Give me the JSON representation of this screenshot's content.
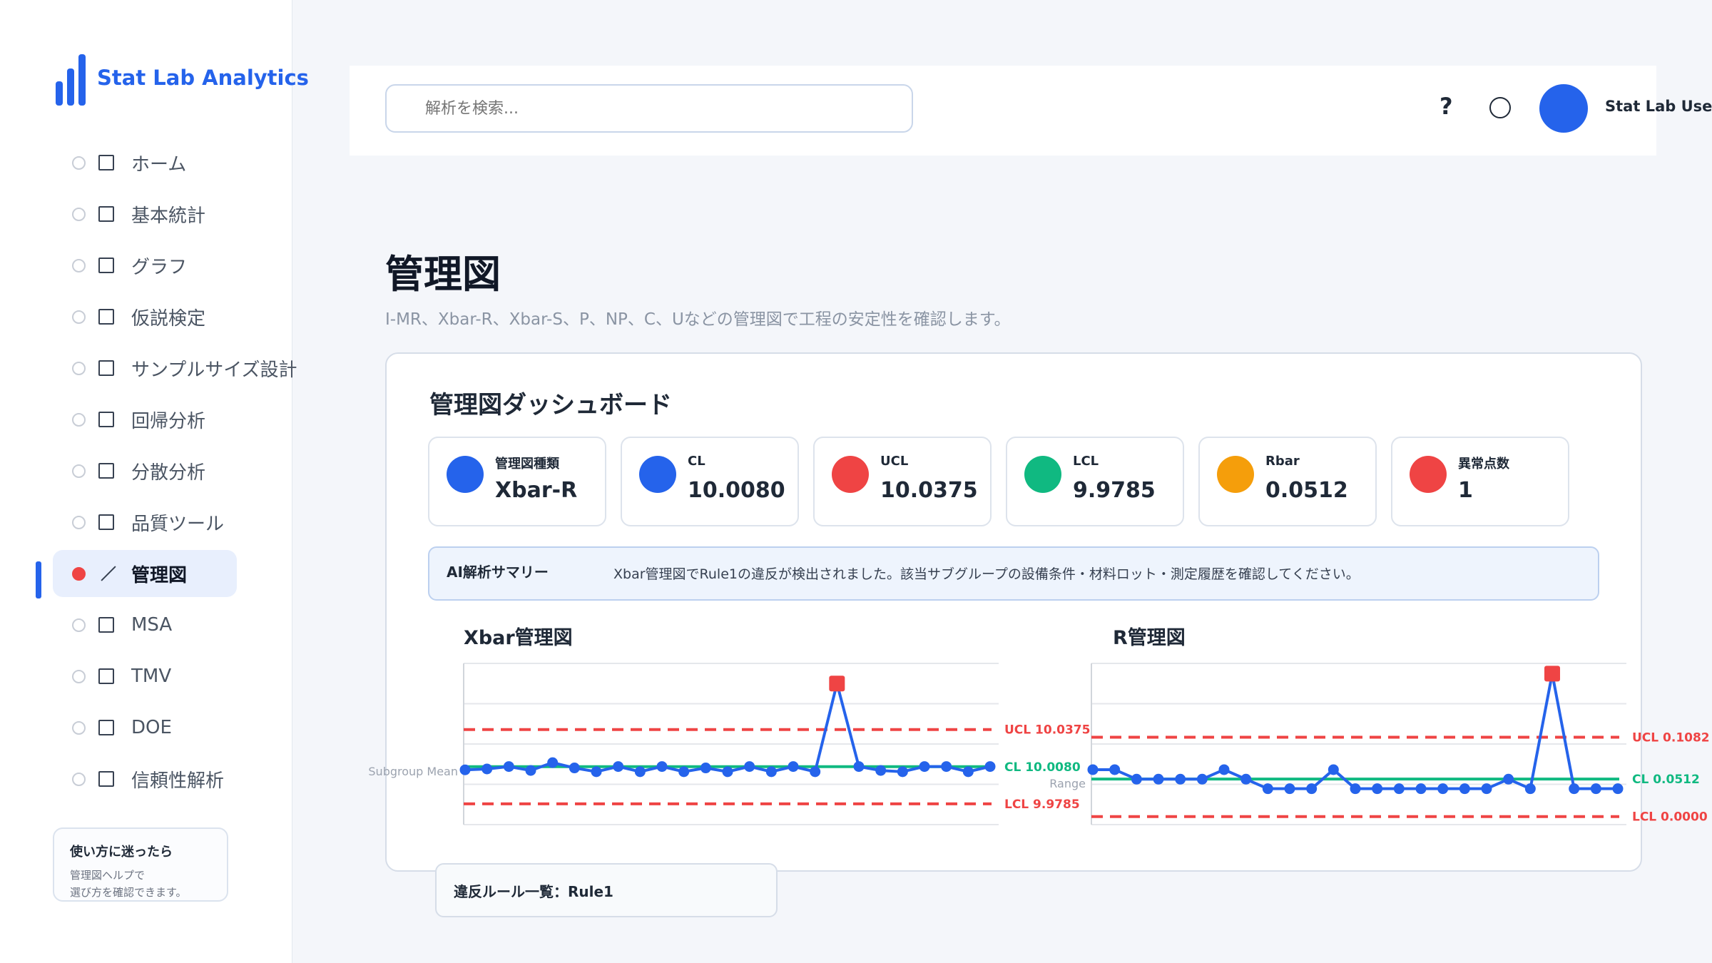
{
  "brand": {
    "name": "Stat Lab Analytics"
  },
  "sidebar": {
    "items": [
      {
        "label": "ホーム"
      },
      {
        "label": "基本統計"
      },
      {
        "label": "グラフ"
      },
      {
        "label": "仮説検定"
      },
      {
        "label": "サンプルサイズ設計"
      },
      {
        "label": "回帰分析"
      },
      {
        "label": "分散分析"
      },
      {
        "label": "品質ツール"
      },
      {
        "label": "管理図"
      },
      {
        "label": "MSA"
      },
      {
        "label": "TMV"
      },
      {
        "label": "DOE"
      },
      {
        "label": "信頼性解析"
      }
    ],
    "active_index": 8,
    "help": {
      "title": "使い方に迷ったら",
      "line1": "管理図ヘルプで",
      "line2": "選び方を確認できます。"
    }
  },
  "topbar": {
    "search_placeholder": "解析を検索...",
    "help_icon": "?",
    "username": "Stat Lab User"
  },
  "page": {
    "title": "管理図",
    "subtitle": "I-MR、Xbar-R、Xbar-S、P、NP、C、Uなどの管理図で工程の安定性を確認します。"
  },
  "dashboard": {
    "title": "管理図ダッシュボード",
    "kpis": [
      {
        "label": "管理図種類",
        "value": "Xbar-R",
        "color": "#2563eb"
      },
      {
        "label": "CL",
        "value": "10.0080",
        "color": "#2563eb"
      },
      {
        "label": "UCL",
        "value": "10.0375",
        "color": "#ef4444"
      },
      {
        "label": "LCL",
        "value": "9.9785",
        "color": "#10b981"
      },
      {
        "label": "Rbar",
        "value": "0.0512",
        "color": "#f59e0b"
      },
      {
        "label": "異常点数",
        "value": "1",
        "color": "#ef4444"
      }
    ],
    "ai_summary": {
      "title": "AI解析サマリー",
      "text": "Xbar管理図でRule1の違反が検出されました。該当サブグループの設備条件・材料ロット・測定履歴を確認してください。"
    },
    "rule_list": "違反ルール一覧：Rule1"
  },
  "chart_data": [
    {
      "type": "line",
      "title": "Xbar管理図",
      "ylabel": "Subgroup Mean",
      "x": [
        1,
        2,
        3,
        4,
        5,
        6,
        7,
        8,
        9,
        10,
        11,
        12,
        13,
        14,
        15,
        16,
        17,
        18,
        19,
        20,
        21,
        22,
        23,
        24,
        25
      ],
      "values": [
        10.0055,
        10.0062,
        10.0081,
        10.005,
        10.0112,
        10.007,
        10.004,
        10.0081,
        10.004,
        10.0081,
        10.004,
        10.007,
        10.004,
        10.0081,
        10.004,
        10.0081,
        10.004,
        10.074,
        10.0081,
        10.005,
        10.004,
        10.0081,
        10.0081,
        10.004,
        10.0081
      ],
      "cl": 10.008,
      "ucl": 10.0375,
      "lcl": 9.9785,
      "cl_label": "CL 10.0080",
      "ucl_label": "UCL 10.0375",
      "lcl_label": "LCL 9.9785",
      "ylim": [
        9.962,
        10.09
      ],
      "violation_index": 17,
      "colors": {
        "line": "#2563eb",
        "cl": "#10b981",
        "limit": "#ef4444"
      }
    },
    {
      "type": "line",
      "title": "R管理図",
      "ylabel": "Range",
      "x": [
        1,
        2,
        3,
        4,
        5,
        6,
        7,
        8,
        9,
        10,
        11,
        12,
        13,
        14,
        15,
        16,
        17,
        18,
        19,
        20,
        21,
        22,
        23,
        24,
        25
      ],
      "values": [
        0.064,
        0.064,
        0.051,
        0.051,
        0.051,
        0.051,
        0.064,
        0.051,
        0.038,
        0.038,
        0.038,
        0.064,
        0.038,
        0.038,
        0.038,
        0.038,
        0.038,
        0.038,
        0.038,
        0.051,
        0.038,
        0.195,
        0.038,
        0.038,
        0.038
      ],
      "cl": 0.0512,
      "ucl": 0.1082,
      "lcl": 0.0,
      "cl_label": "CL 0.0512",
      "ucl_label": "UCL 0.1082",
      "lcl_label": "LCL 0.0000",
      "ylim": [
        -0.011,
        0.209
      ],
      "violation_index": 21,
      "colors": {
        "line": "#2563eb",
        "cl": "#10b981",
        "limit": "#ef4444"
      }
    }
  ]
}
